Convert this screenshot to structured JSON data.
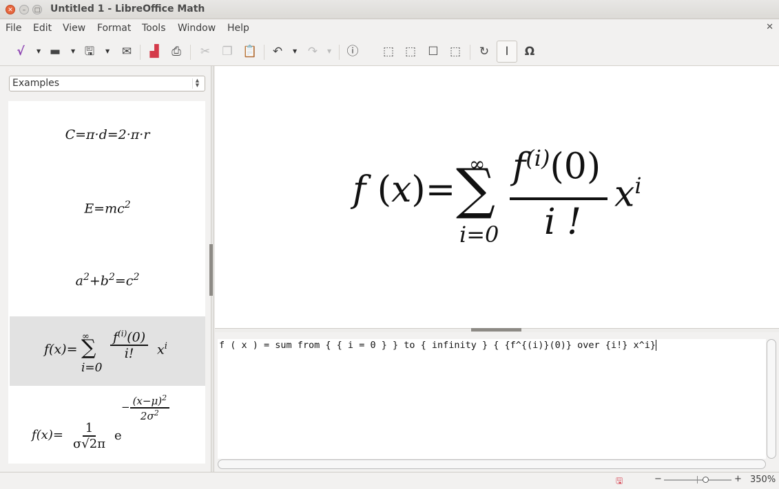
{
  "window": {
    "title": "Untitled 1 - LibreOffice Math"
  },
  "menu": [
    {
      "label": "File"
    },
    {
      "label": "Edit"
    },
    {
      "label": "View"
    },
    {
      "label": "Format"
    },
    {
      "label": "Tools"
    },
    {
      "label": "Window"
    },
    {
      "label": "Help"
    }
  ],
  "toolbar": [
    "formula-icon",
    "open-icon",
    "save-icon",
    "email-icon",
    "export-pdf-icon",
    "print-icon",
    "cut-icon",
    "copy-icon",
    "paste-icon",
    "undo-icon",
    "redo-icon",
    "formula-cursor-info-icon",
    "zoom-in-icon",
    "zoom-out-icon",
    "show-all-icon",
    "zoom-100-icon",
    "update-icon",
    "formula-cursor-icon",
    "symbols-icon"
  ],
  "left": {
    "dropdown": "Examples",
    "examples": [
      "C=π·d=2·π·r",
      "E=mc^2",
      "a^2+b^2=c^2",
      "f(x)=sum from i=0 to infinity f^(i)(0)/i! x^i",
      "f(x)=1/(σ√2π) e^(-(x-μ)^2/2σ^2)"
    ]
  },
  "preview": {
    "lhs": "f",
    "paren_open": "(",
    "var": "x",
    "paren_close": ")",
    "eq": "=",
    "sum": "∑",
    "upper": "∞",
    "lower": "i=0",
    "num_f": "f",
    "num_sup": "(i)",
    "num_arg": "(0)",
    "den": "i !",
    "x": "x",
    "x_sup": "i"
  },
  "editor": {
    "text": "f ( x ) = sum from { { i = 0 } } to { infinity } { {f^{(i)}(0)} over {i!} x^i}"
  },
  "status": {
    "zoom": "350%",
    "zoom_fraction": 0.62,
    "minus": "−",
    "plus": "+"
  }
}
